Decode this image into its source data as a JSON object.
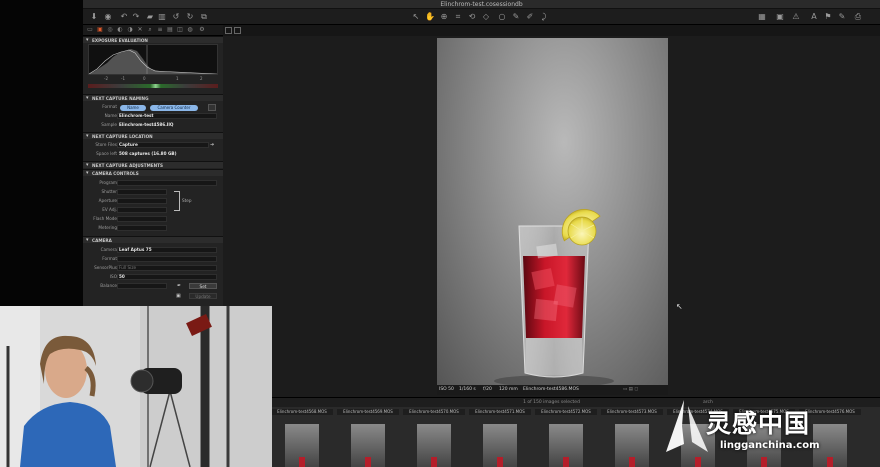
{
  "window": {
    "title": "Elinchrom-test.cosessiondb"
  },
  "panel": {
    "sections": {
      "exposure": "EXPOSURE EVALUATION",
      "naming": "NEXT CAPTURE NAMING",
      "location": "NEXT CAPTURE LOCATION",
      "adjustments": "NEXT CAPTURE ADJUSTMENTS",
      "camera_controls": "CAMERA CONTROLS",
      "camera": "CAMERA"
    },
    "histogram_axis": [
      "-2",
      "-1",
      "0",
      "1",
      "2"
    ],
    "naming": {
      "format_label": "Format",
      "format_tokens": [
        "Name",
        "Camera Counter"
      ],
      "name_label": "Name",
      "name_value": "Elinchrom-test",
      "sample_label": "Sample",
      "sample_value": "Elinchrom-test4586.IIQ"
    },
    "location": {
      "store_label": "Store Files",
      "store_value": "Capture",
      "space_label": "Space left",
      "space_value": "508 captures (16.80 GB)"
    },
    "camera_controls": {
      "program_label": "Program",
      "shutter_label": "Shutter",
      "aperture_label": "Aperture",
      "ev_label": "EV Adj.",
      "flash_label": "Flash Mode",
      "metering_label": "Metering",
      "step_label": "Step"
    },
    "camera": {
      "camera_label": "Camera",
      "camera_value": "Leaf Aptus 75",
      "format_label": "Format",
      "sensorplus_label": "SensorPlus",
      "sensorplus_value": "Full Size",
      "iso_label": "ISO",
      "iso_value": "50",
      "balance_label": "Balance",
      "set_label": "Set",
      "update_label": "Update"
    }
  },
  "viewer": {
    "info": {
      "iso": "ISO 50",
      "shutter": "1/160 s",
      "aperture": "f/20",
      "focal": "120 mm",
      "filename": "Elinchrom-test4586.MOS"
    }
  },
  "filmstrip": {
    "status": "1 of 150 images selected",
    "search_label": "arch",
    "thumbs": [
      {
        "name": "Elinchrom-test4568.MOS"
      },
      {
        "name": "Elinchrom-test4569.MOS"
      },
      {
        "name": "Elinchrom-test4570.MOS"
      },
      {
        "name": "Elinchrom-test4571.MOS"
      },
      {
        "name": "Elinchrom-test4572.MOS"
      },
      {
        "name": "Elinchrom-test4573.MOS"
      },
      {
        "name": "Elinchrom-test4574.MOS"
      },
      {
        "name": "Elinchrom-test4575.MOS"
      },
      {
        "name": "Elinchrom-test4576.MOS"
      }
    ]
  },
  "watermark": {
    "title": "灵感中国",
    "subtitle": "lingganchina.com"
  }
}
